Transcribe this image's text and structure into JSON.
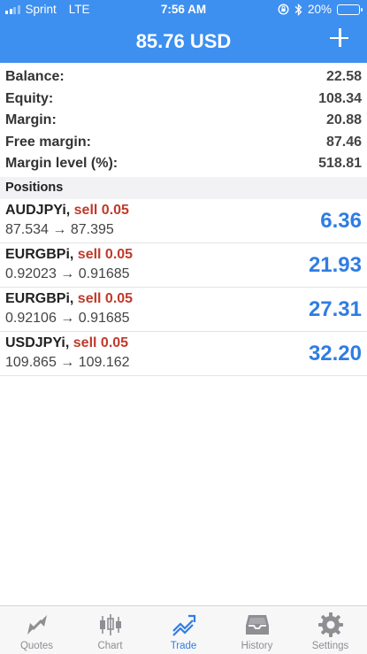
{
  "status_bar": {
    "carrier": "Sprint",
    "network": "LTE",
    "time": "7:56 AM",
    "battery_percent": "20%",
    "battery_level": 0.2
  },
  "header": {
    "title": "85.76 USD",
    "add_icon": "plus-icon"
  },
  "summary": [
    {
      "label": "Balance:",
      "value": "22.58"
    },
    {
      "label": "Equity:",
      "value": "108.34"
    },
    {
      "label": "Margin:",
      "value": "20.88"
    },
    {
      "label": "Free margin:",
      "value": "87.46"
    },
    {
      "label": "Margin level (%):",
      "value": "518.81"
    }
  ],
  "positions_title": "Positions",
  "positions": [
    {
      "symbol": "AUDJPYi,",
      "side": "sell 0.05",
      "prices": "87.534 → 87.395",
      "profit": "6.36"
    },
    {
      "symbol": "EURGBPi,",
      "side": "sell 0.05",
      "prices": "0.92023 → 0.91685",
      "profit": "21.93"
    },
    {
      "symbol": "EURGBPi,",
      "side": "sell 0.05",
      "prices": "0.92106 → 0.91685",
      "profit": "27.31"
    },
    {
      "symbol": "USDJPYi,",
      "side": "sell 0.05",
      "prices": "109.865 → 109.162",
      "profit": "32.20"
    }
  ],
  "tabs": [
    {
      "label": "Quotes",
      "icon": "quotes-icon",
      "active": false
    },
    {
      "label": "Chart",
      "icon": "candlestick-icon",
      "active": false
    },
    {
      "label": "Trade",
      "icon": "trade-icon",
      "active": true
    },
    {
      "label": "History",
      "icon": "inbox-icon",
      "active": false
    },
    {
      "label": "Settings",
      "icon": "gear-icon",
      "active": false
    }
  ],
  "colors": {
    "accent": "#3d8ff0",
    "profit": "#2f7de3",
    "sell": "#c0392b",
    "tab_inactive": "#8e8e93"
  }
}
